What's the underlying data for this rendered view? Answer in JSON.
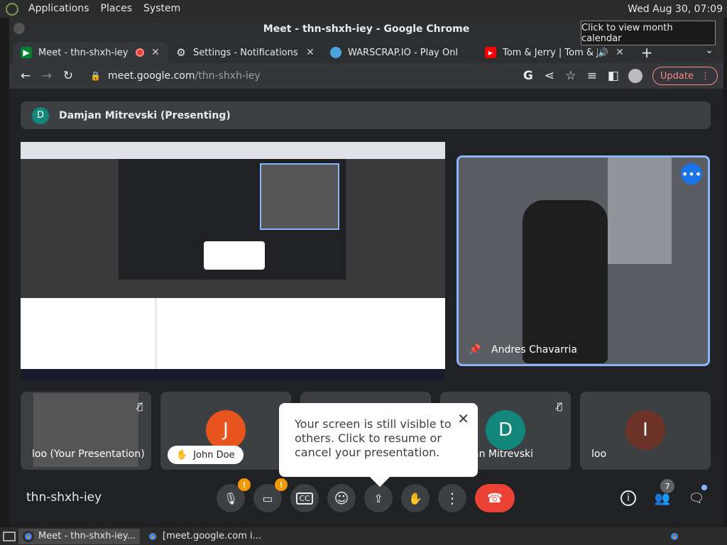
{
  "panel": {
    "menus": [
      "Applications",
      "Places",
      "System"
    ],
    "clock": "Wed Aug 30, 07:09",
    "tooltip": "Click to view month calendar"
  },
  "window": {
    "title": "Meet - thn-shxh-iey - Google Chrome"
  },
  "tabs": [
    {
      "title": "Meet - thn-shxh-iey",
      "icon": "meet-icon",
      "recording": true
    },
    {
      "title": "Settings - Notifications",
      "icon": "gear-icon"
    },
    {
      "title": "WARSCRAP.IO   - Play Onl",
      "icon": "warscrap-icon"
    },
    {
      "title": "Tom & Jerry | Tom & Je",
      "icon": "youtube-icon",
      "audio": true
    }
  ],
  "toolbar": {
    "url_host": "meet.google.com",
    "url_path": "/thn-shxh-iey",
    "update_label": "Update"
  },
  "meet": {
    "presenter_initial": "D",
    "presenter_label": "Damjan Mitrevski (Presenting)",
    "featured": {
      "name": "Andres Chavarria"
    },
    "participants": [
      {
        "name": "loo (Your Presentation)",
        "initial": ""
      },
      {
        "name": "John Doe",
        "initial": "J",
        "color": "#e8541e"
      },
      {
        "name": "an Mitrevski",
        "initial": "D",
        "color": "#12867a"
      },
      {
        "name": "loo",
        "initial": "I",
        "color": "#6d3328"
      }
    ],
    "popover_text": "Your screen is still visible to others. Click to resume or cancel your presentation.",
    "meeting_code": "thn-shxh-iey",
    "mic_warning": "!",
    "cam_warning": "!",
    "people_count": "7"
  },
  "taskbar": {
    "items": [
      "Meet - thn-shxh-iey...",
      "[meet.google.com i..."
    ]
  }
}
